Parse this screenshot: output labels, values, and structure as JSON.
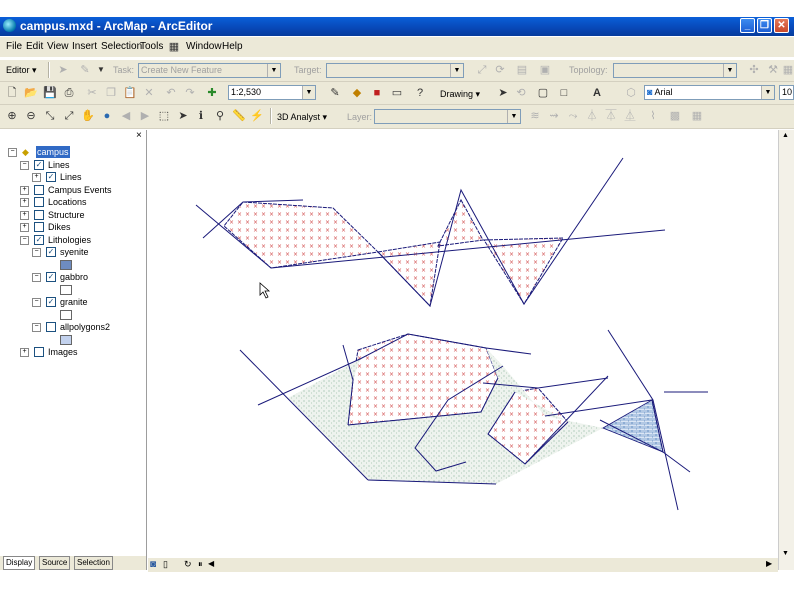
{
  "window": {
    "title": "campus.mxd - ArcMap - ArcEditor",
    "min": "_",
    "max": "❐",
    "close": "✕"
  },
  "menu": [
    "File",
    "Edit",
    "View",
    "Insert",
    "Selection",
    "Tools",
    "Window",
    "Help"
  ],
  "editor_toolbar": {
    "editor_label": "Editor ▾",
    "task_label": "Task:",
    "task_value": "Create New Feature",
    "target_label": "Target:",
    "target_value": "",
    "topology_label": "Topology:",
    "topology_value": ""
  },
  "standard_toolbar": {
    "scale": "1:2,530",
    "drawing_label": "Drawing ▾",
    "font": "Arial",
    "font_size": "10"
  },
  "tools_toolbar": {
    "analyst": "3D Analyst ▾",
    "layer_label": "Layer:",
    "layer_value": ""
  },
  "toc": {
    "close_glyph": "×",
    "items": [
      {
        "label": "campus",
        "indent": 0,
        "expander": "−",
        "checkbox": false,
        "selected": true,
        "frame": true
      },
      {
        "label": "Lines",
        "indent": 1,
        "expander": "−",
        "checkbox": true,
        "checked": true
      },
      {
        "label": "Lines",
        "indent": 2,
        "expander": "+",
        "checkbox": true,
        "checked": true
      },
      {
        "label": "Campus Events",
        "indent": 1,
        "expander": "+",
        "checkbox": true,
        "checked": false
      },
      {
        "label": "Locations",
        "indent": 1,
        "expander": "+",
        "checkbox": true,
        "checked": false
      },
      {
        "label": "Structure",
        "indent": 1,
        "expander": "+",
        "checkbox": true,
        "checked": false
      },
      {
        "label": "Dikes",
        "indent": 1,
        "expander": "+",
        "checkbox": true,
        "checked": false
      },
      {
        "label": "Lithologies",
        "indent": 1,
        "expander": "−",
        "checkbox": true,
        "checked": true
      },
      {
        "label": "syenite",
        "indent": 2,
        "expander": "−",
        "checkbox": true,
        "checked": true,
        "symbol": "#6e8cc0"
      },
      {
        "label": "gabbro",
        "indent": 2,
        "expander": "−",
        "checkbox": true,
        "checked": true,
        "symbol": "#ffffff"
      },
      {
        "label": "granite",
        "indent": 2,
        "expander": "−",
        "checkbox": true,
        "checked": true,
        "symbol": "#ffffff"
      },
      {
        "label": "allpolygons2",
        "indent": 2,
        "expander": "−",
        "checkbox": true,
        "checked": false,
        "symbol": "#c3d2ee"
      },
      {
        "label": "Images",
        "indent": 1,
        "expander": "+",
        "checkbox": true,
        "checked": false
      }
    ],
    "tabs": [
      "Display",
      "Source",
      "Selection"
    ]
  },
  "colors": {
    "titlebar": "#0847b6",
    "chrome": "#ece9d8",
    "line": "#1a1a7a",
    "granite_hatch": "#d04848",
    "gabbro_fill": "#8fb59f",
    "syenite_fill": "#3a6fb0"
  }
}
